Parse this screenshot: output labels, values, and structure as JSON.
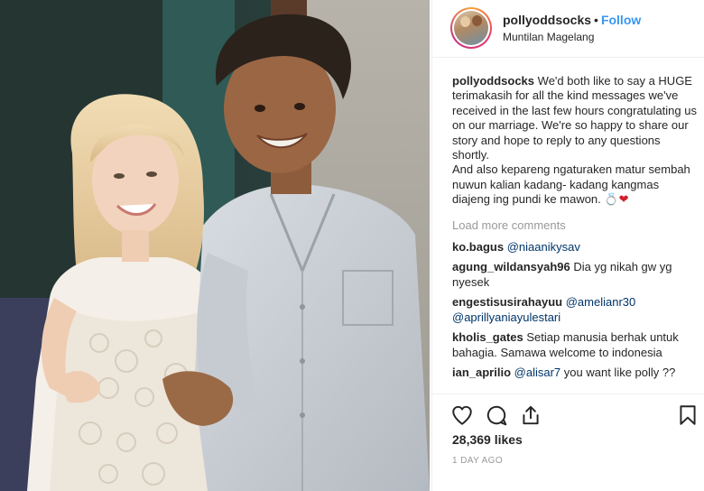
{
  "post": {
    "username": "pollyoddsocks",
    "separator": "•",
    "follow_label": "Follow",
    "location": "Muntilan Magelang"
  },
  "caption": {
    "username": "pollyoddsocks",
    "text_1": "We'd both like to say a HUGE terimakasih for all the kind messages we've received in the last few hours congratulating us on our marriage. We're so happy to share our story and hope to reply to any questions shortly.",
    "text_2": "And also kepareng ngaturaken matur sembah nuwun kalian kadang- kadang kangmas diajeng ing pundi ke mawon.",
    "emoji_ring": "💍",
    "emoji_heart": "❤"
  },
  "load_more_label": "Load more comments",
  "comments": [
    {
      "username": "ko.bagus",
      "mention": "@niaanikysav",
      "text": ""
    },
    {
      "username": "agung_wildansyah96",
      "mention": "",
      "text": "Dia yg nikah gw yg nyesek"
    },
    {
      "username": "engestisusirahayuu",
      "mention": "@amelianr30",
      "mention2": "@aprillyaniayulestari",
      "text": ""
    },
    {
      "username": "kholis_gates",
      "mention": "",
      "text": "Setiap manusia berhak untuk bahagia. Samawa welcome to indonesia"
    },
    {
      "username": "ian_aprilio",
      "mention": "@alisar7",
      "text": "you want like polly ??"
    }
  ],
  "likes": "28,369 likes",
  "timestamp": "1 DAY AGO",
  "icons": {
    "like": "heart-icon",
    "comment": "comment-icon",
    "share": "share-icon",
    "save": "bookmark-icon"
  },
  "colors": {
    "link_blue": "#3897f0",
    "mention_blue": "#003569",
    "muted": "#999999",
    "text": "#262626"
  }
}
